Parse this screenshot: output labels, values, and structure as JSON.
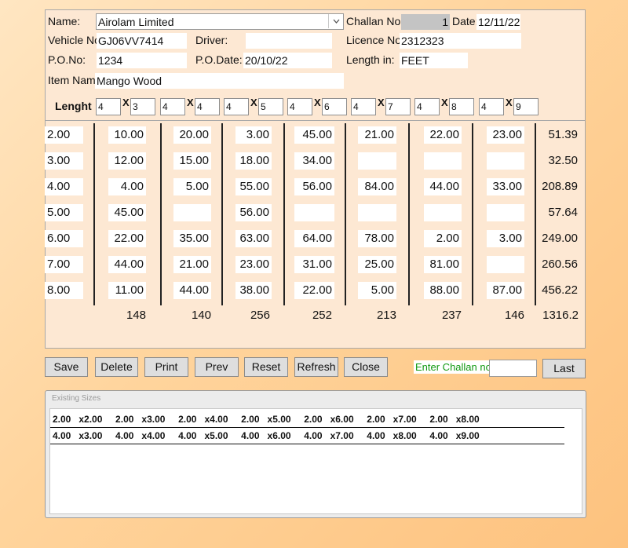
{
  "header": {
    "name_label": "Name:",
    "name_value": "Airolam Limited",
    "challan_label": "Challan No:",
    "challan_value": "1",
    "date_label": "Date:",
    "date_value": "12/11/22",
    "vehicle_label": "Vehicle No:",
    "vehicle_value": "GJ06VV7414",
    "driver_label": "Driver:",
    "driver_value": "",
    "licence_label": "Licence No:",
    "licence_value": "2312323",
    "po_label": "P.O.No:",
    "po_value": "1234",
    "podate_label": "P.O.Date:",
    "podate_value": "20/10/22",
    "length_in_label": "Length in:",
    "length_in_value": "FEET",
    "item_label": "Item Name:",
    "item_value": "Mango Wood"
  },
  "lenght": {
    "label": "Lenght",
    "x_glyph": "X",
    "pairs": [
      [
        "4",
        "3"
      ],
      [
        "4",
        "4"
      ],
      [
        "4",
        "5"
      ],
      [
        "4",
        "6"
      ],
      [
        "4",
        "7"
      ],
      [
        "4",
        "8"
      ],
      [
        "4",
        "9"
      ]
    ]
  },
  "grid": {
    "row_labels": [
      "2.00",
      "3.00",
      "4.00",
      "5.00",
      "6.00",
      "7.00",
      "8.00"
    ],
    "rows": [
      [
        "10.00",
        "20.00",
        "3.00",
        "45.00",
        "21.00",
        "22.00",
        "23.00",
        "51.39"
      ],
      [
        "12.00",
        "15.00",
        "18.00",
        "34.00",
        "",
        "",
        "",
        "32.50"
      ],
      [
        "4.00",
        "5.00",
        "55.00",
        "56.00",
        "84.00",
        "44.00",
        "33.00",
        "208.89"
      ],
      [
        "45.00",
        "",
        "56.00",
        "",
        "",
        "",
        "",
        "57.64"
      ],
      [
        "22.00",
        "35.00",
        "63.00",
        "64.00",
        "78.00",
        "2.00",
        "3.00",
        "249.00"
      ],
      [
        "44.00",
        "21.00",
        "23.00",
        "31.00",
        "25.00",
        "81.00",
        "",
        "260.56"
      ],
      [
        "11.00",
        "44.00",
        "38.00",
        "22.00",
        "5.00",
        "88.00",
        "87.00",
        "456.22"
      ]
    ],
    "totals": [
      "148",
      "140",
      "256",
      "252",
      "213",
      "237",
      "146",
      "1316.2"
    ]
  },
  "buttons": {
    "save": "Save",
    "delete": "Delete",
    "print": "Print",
    "prev": "Prev",
    "reset": "Reset",
    "refresh": "Refresh",
    "close": "Close",
    "last": "Last"
  },
  "enter_challan_label": "Enter Challan no:",
  "enter_challan_value": "",
  "existing_sizes": {
    "title": "Existing Sizes",
    "rows": [
      "2.00   x2.00     2.00   x3.00     2.00   x4.00     2.00   x5.00     2.00   x6.00     2.00   x7.00     2.00   x8.00",
      "4.00   x3.00     4.00   x4.00     4.00   x5.00     4.00   x6.00     4.00   x7.00     4.00   x8.00     4.00   x9.00"
    ]
  },
  "colors": {
    "panel_bg": "#fde8d3",
    "enter_challan_text": "#119911",
    "button_bg": "#dedede"
  }
}
